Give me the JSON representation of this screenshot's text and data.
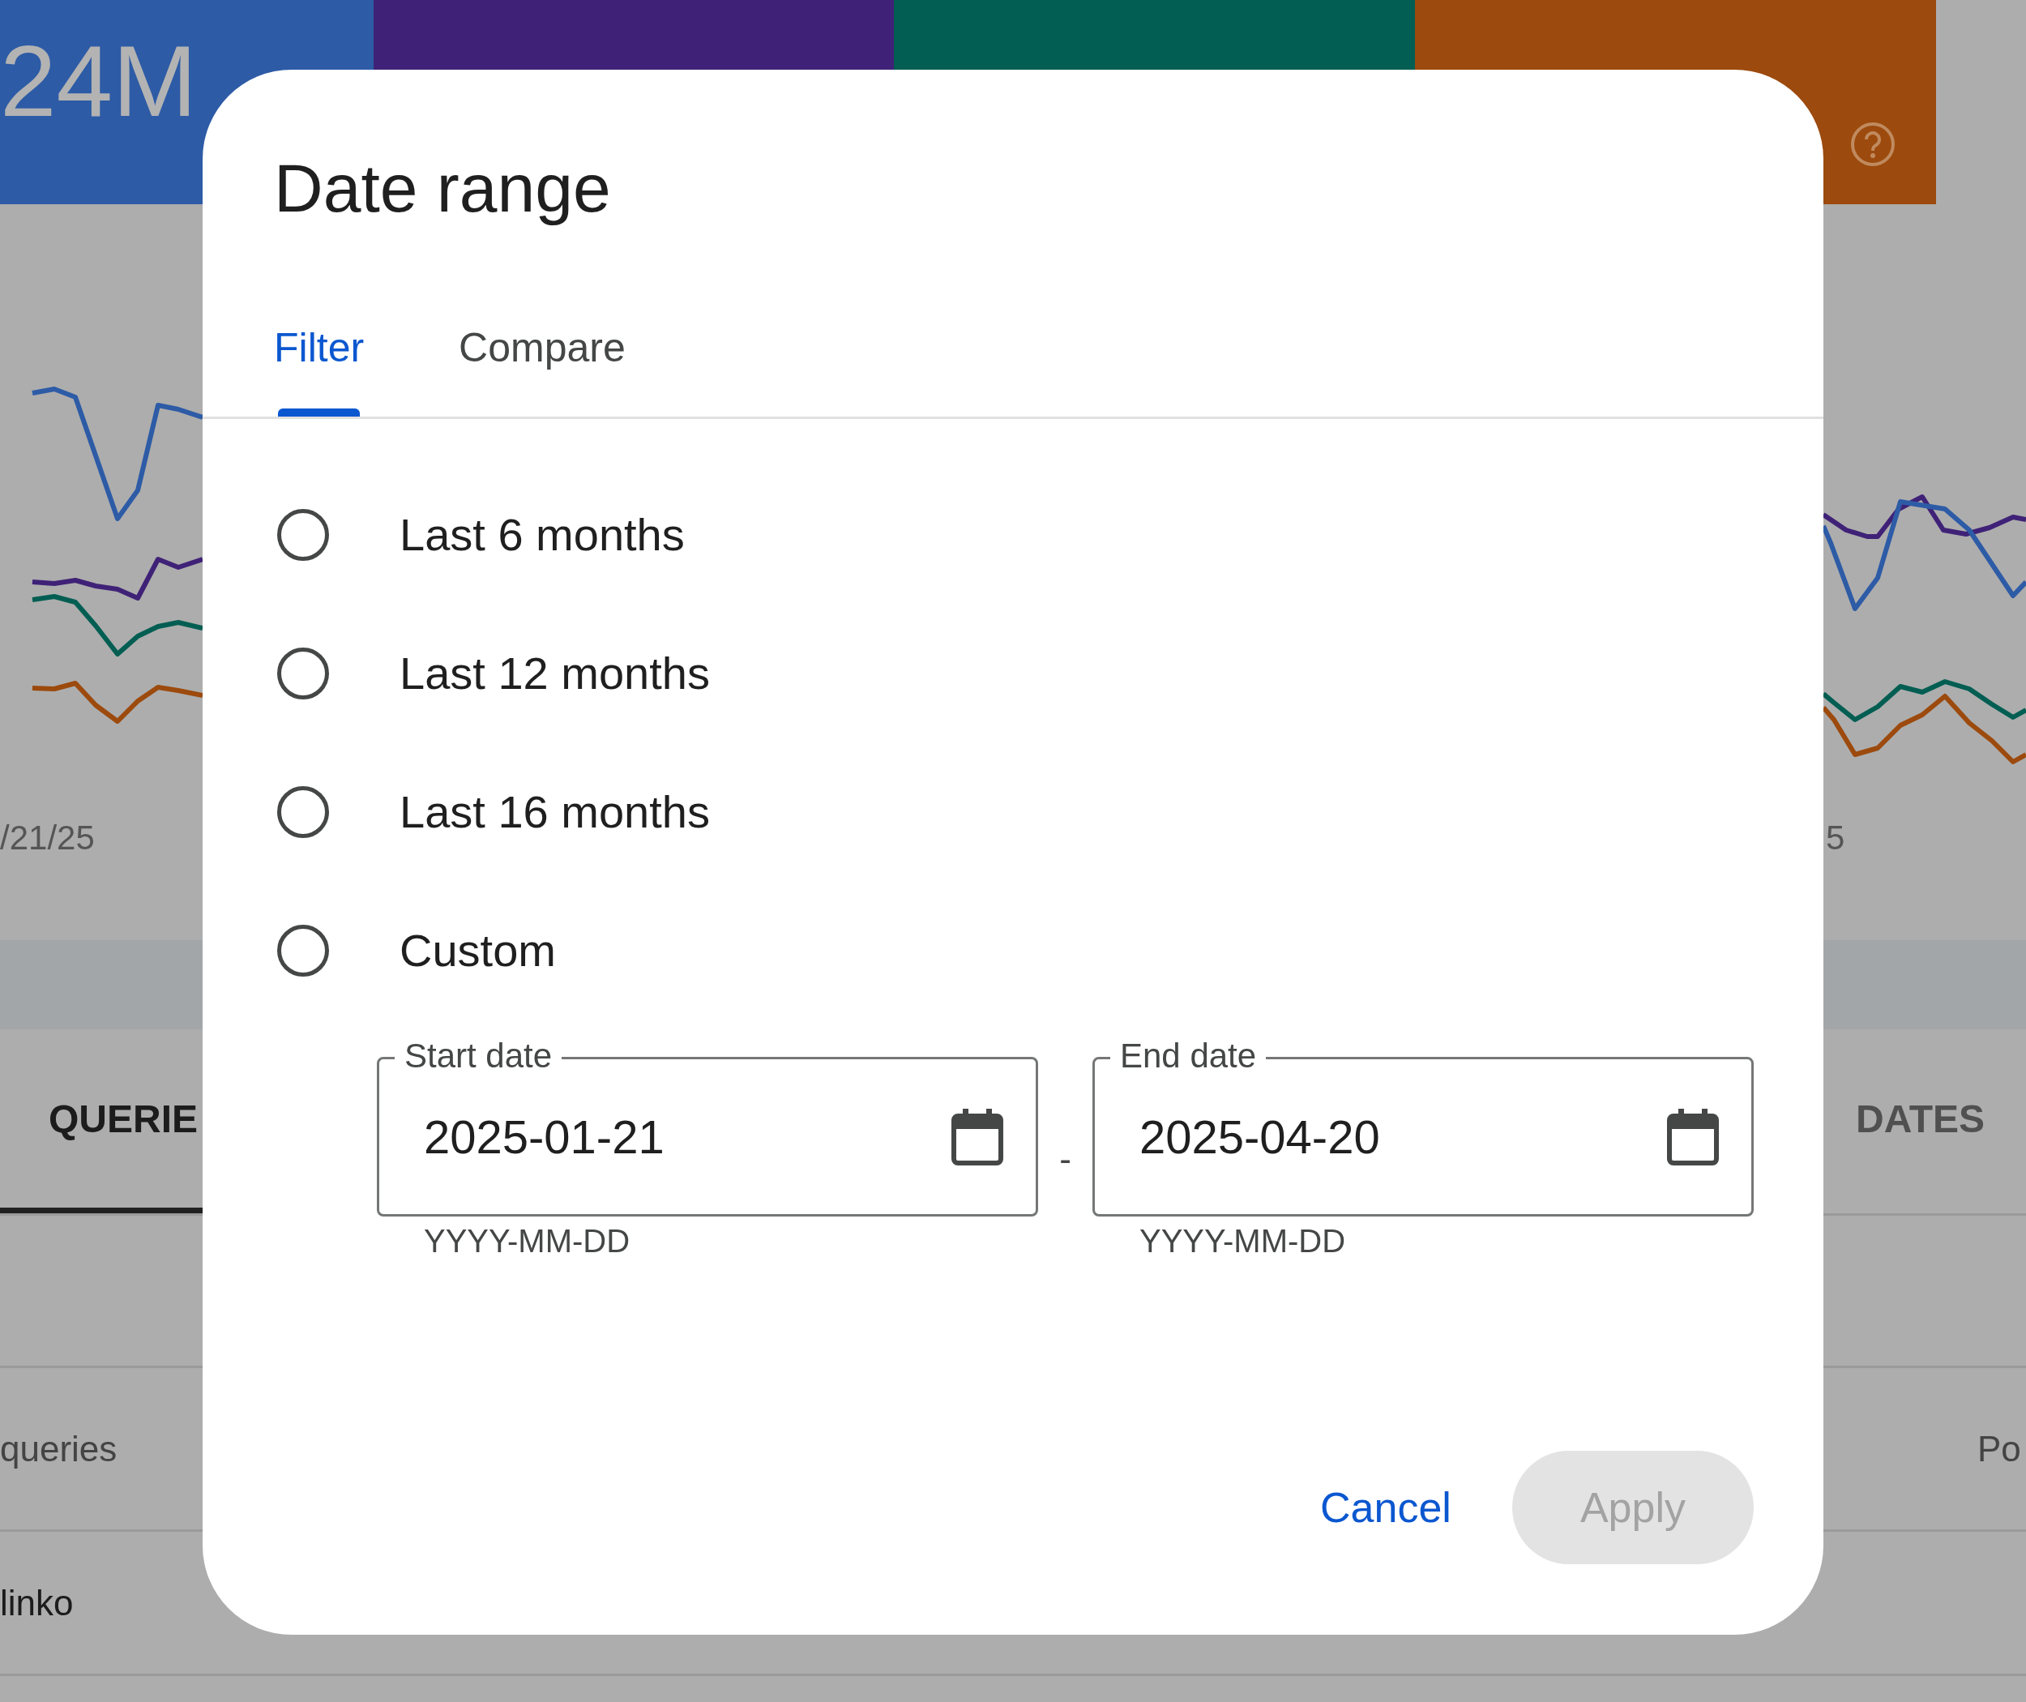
{
  "background": {
    "metrics": [
      {
        "value": "24M",
        "color": "#2d5ba6",
        "dark_text": false
      },
      {
        "color": "#3f2277"
      },
      {
        "color": "#025e52"
      },
      {
        "color": "#9c4a0d",
        "help_icon": true
      }
    ],
    "chart_axis": [
      "/21/25",
      "5"
    ],
    "tabs": [
      {
        "label": "QUERIE",
        "selected": true
      },
      {
        "label": "DATES",
        "selected": false
      }
    ],
    "table_header": [
      "queries",
      "Po"
    ],
    "rows": [
      "linko"
    ]
  },
  "dialog": {
    "title": "Date range",
    "tabs": [
      {
        "label": "Filter",
        "selected": true
      },
      {
        "label": "Compare",
        "selected": false
      }
    ],
    "options": [
      {
        "label": "Last 6 months",
        "selected": false
      },
      {
        "label": "Last 12 months",
        "selected": false
      },
      {
        "label": "Last 16 months",
        "selected": false
      },
      {
        "label": "Custom",
        "selected": false
      }
    ],
    "fields": [
      {
        "label": "Start date",
        "value": "2025-01-21",
        "hint": "YYYY-MM-DD"
      },
      {
        "label": "End date",
        "value": "2025-04-20",
        "hint": "YYYY-MM-DD"
      }
    ],
    "separator": "-",
    "buttons": [
      {
        "label": "Cancel",
        "kind": "text",
        "disabled": false
      },
      {
        "label": "Apply",
        "kind": "filled",
        "disabled": true
      }
    ]
  }
}
